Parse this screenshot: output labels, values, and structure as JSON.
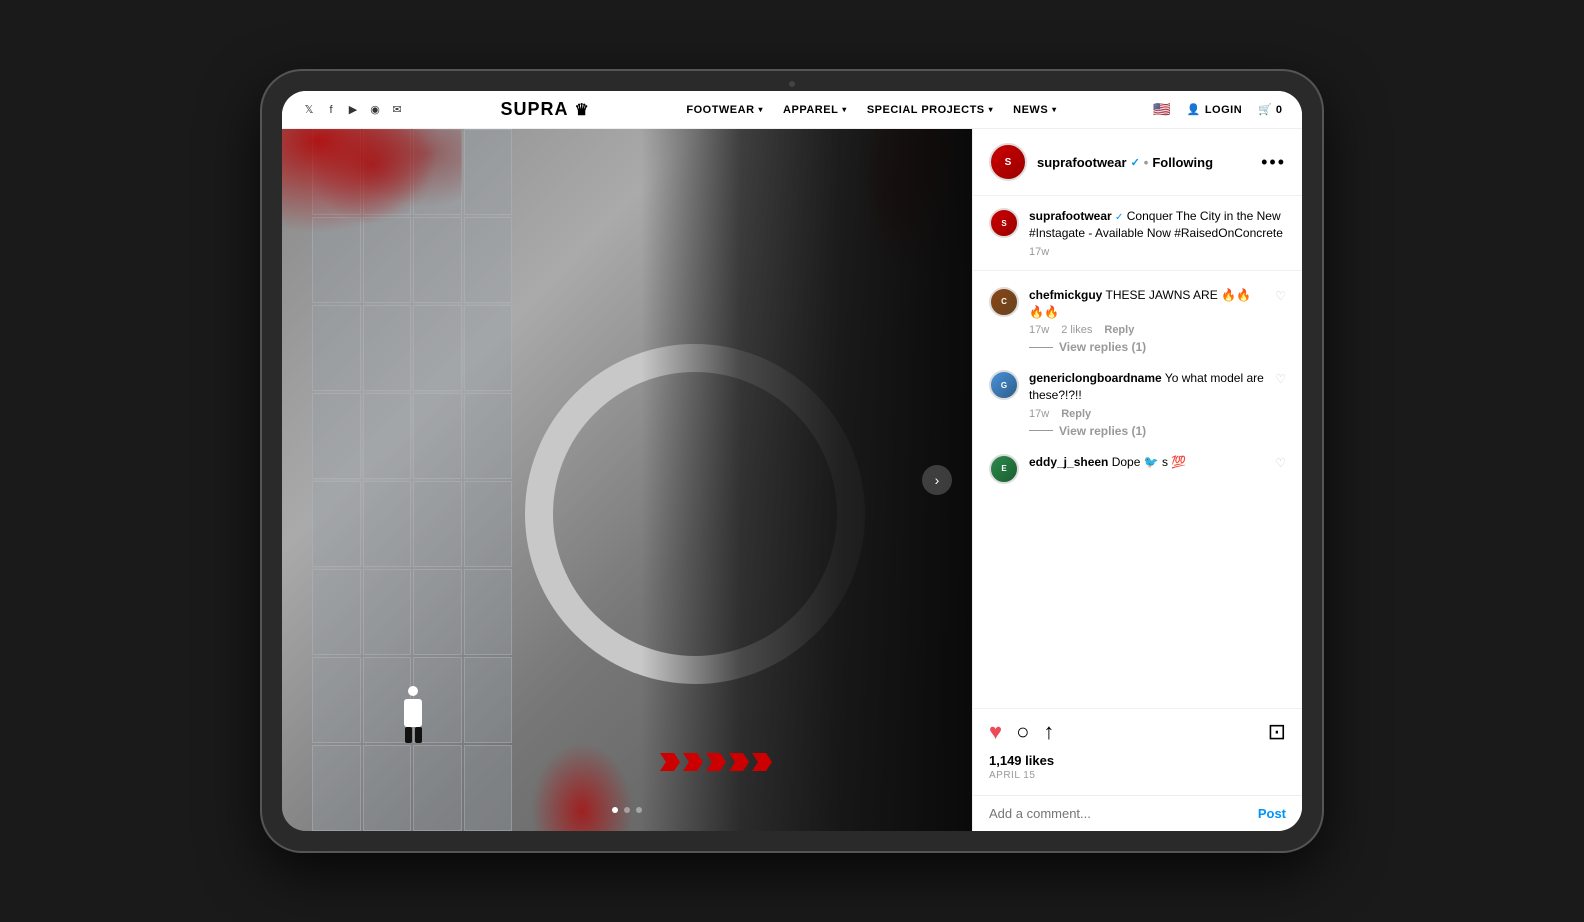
{
  "tablet": {
    "frame_color": "#2a2a2a"
  },
  "nav": {
    "logo": "SUPRA",
    "logo_icon": "👑",
    "social_links": [
      "twitter",
      "facebook",
      "youtube",
      "instagram",
      "email"
    ],
    "menu_items": [
      {
        "label": "FOOTWEAR",
        "has_dropdown": true
      },
      {
        "label": "APPAREL",
        "has_dropdown": true
      },
      {
        "label": "SPECIAL PROJECTS",
        "has_dropdown": true
      },
      {
        "label": "NEWS",
        "has_dropdown": true
      }
    ],
    "login_label": "LOGIN",
    "cart_count": "0",
    "flag": "🇺🇸"
  },
  "hero": {
    "next_button_label": "›",
    "arrows_count": 5,
    "dots": [
      {
        "active": true
      },
      {
        "active": false
      },
      {
        "active": false
      }
    ]
  },
  "instagram": {
    "header": {
      "username": "suprafootwear",
      "verified": true,
      "following_label": "Following",
      "more_icon": "•••"
    },
    "caption": {
      "username": "suprafootwear",
      "verified": true,
      "text": "Conquer The City in the New #Instagate - Available Now #RaisedOnConcrete",
      "time": "17w"
    },
    "comments": [
      {
        "id": "comment-1",
        "username": "chefmickguy",
        "text": "THESE JAWNS ARE 🔥🔥🔥🔥",
        "time": "17w",
        "likes": "2 likes",
        "reply_label": "Reply",
        "view_replies": "View replies (1)",
        "liked": false,
        "avatar_class": "avatar-chef"
      },
      {
        "id": "comment-2",
        "username": "genericlongboardname",
        "text": "Yo what model are these?!?!!",
        "time": "17w",
        "likes": "",
        "reply_label": "Reply",
        "view_replies": "View replies (1)",
        "liked": false,
        "avatar_class": "avatar-generic"
      },
      {
        "id": "comment-3",
        "username": "eddy_j_sheen",
        "text": "Dope 🐦 s 💯",
        "time": "",
        "likes": "",
        "reply_label": "",
        "view_replies": "",
        "liked": false,
        "avatar_class": "avatar-eddy"
      }
    ],
    "actions": {
      "likes_count": "1,149 likes",
      "post_date": "APRIL 15"
    },
    "comment_input": {
      "placeholder": "Add a comment...",
      "post_label": "Post"
    }
  }
}
